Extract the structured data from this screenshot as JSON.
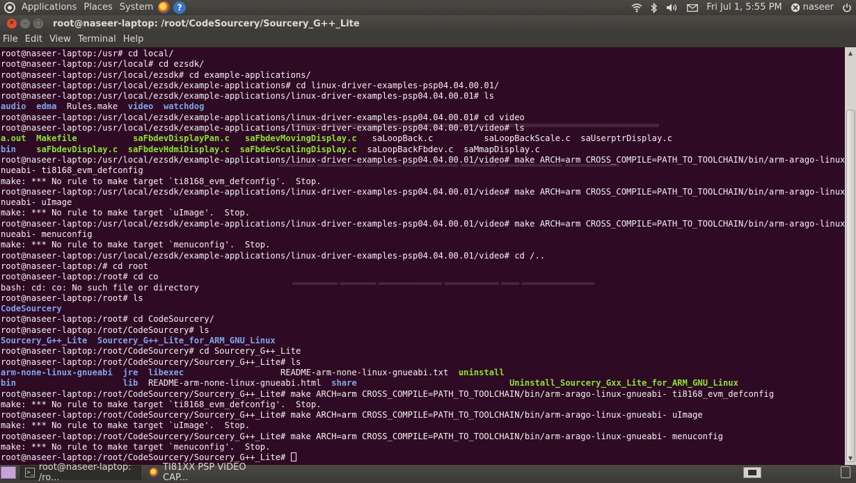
{
  "top_panel": {
    "menus": [
      "Applications",
      "Places",
      "System"
    ],
    "datetime": "Fri Jul  1,  5:55 PM",
    "user": "naseer"
  },
  "window": {
    "title": "root@naseer-laptop: /root/CodeSourcery/Sourcery_G++_Lite",
    "menu": [
      "File",
      "Edit",
      "View",
      "Terminal",
      "Help"
    ]
  },
  "terminal": {
    "lines": [
      [
        {
          "t": "root@naseer-laptop:/usr# cd local/"
        }
      ],
      [
        {
          "t": "root@naseer-laptop:/usr/local# cd ezsdk/"
        }
      ],
      [
        {
          "t": "root@naseer-laptop:/usr/local/ezsdk# cd example-applications/"
        }
      ],
      [
        {
          "t": "root@naseer-laptop:/usr/local/ezsdk/example-applications# cd linux-driver-examples-psp04.04.00.01/"
        }
      ],
      [
        {
          "t": "root@naseer-laptop:/usr/local/ezsdk/example-applications/linux-driver-examples-psp04.04.00.01# ls"
        }
      ],
      [
        {
          "t": "audio",
          "c": "dir"
        },
        {
          "t": "  "
        },
        {
          "t": "edma",
          "c": "dir"
        },
        {
          "t": "  Rules.make  "
        },
        {
          "t": "video",
          "c": "dir"
        },
        {
          "t": "  "
        },
        {
          "t": "watchdog",
          "c": "dir"
        }
      ],
      [
        {
          "t": "root@naseer-laptop:/usr/local/ezsdk/example-applications/linux-driver-examples-psp04.04.00.01# cd video"
        }
      ],
      [
        {
          "t": "root@naseer-laptop:/usr/local/ezsdk/example-applications/linux-driver-examples-psp04.04.00.01/video# ls"
        }
      ],
      [
        {
          "t": "a.out",
          "c": "exe"
        },
        {
          "t": "  "
        },
        {
          "t": "Makefile",
          "c": "exe"
        },
        {
          "t": "           "
        },
        {
          "t": "saFbdevDisplayPan.c",
          "c": "exe"
        },
        {
          "t": "   "
        },
        {
          "t": "saFbdevMovingDisplay.c",
          "c": "exe"
        },
        {
          "t": "   saLoopBack.c          saLoopBackScale.c  saUserptrDisplay.c"
        }
      ],
      [
        {
          "t": "bin",
          "c": "dir"
        },
        {
          "t": "    "
        },
        {
          "t": "saFbdevDisplay.c",
          "c": "exe"
        },
        {
          "t": "  "
        },
        {
          "t": "saFbdevHdmiDisplay.c",
          "c": "exe"
        },
        {
          "t": "  "
        },
        {
          "t": "saFbdevScalingDisplay.c",
          "c": "exe"
        },
        {
          "t": "  saLoopBackFbdev.c  saMmapDisplay.c"
        }
      ],
      [
        {
          "t": "root@naseer-laptop:/usr/local/ezsdk/example-applications/linux-driver-examples-psp04.04.00.01/video# make ARCH=arm CROSS_COMPILE=PATH_TO_TOOLCHAIN/bin/arm-arago-linux-g"
        }
      ],
      [
        {
          "t": "nueabi- ti8168_evm_defconfig"
        }
      ],
      [
        {
          "t": "make: *** No rule to make target `ti8168_evm_defconfig'.  Stop."
        }
      ],
      [
        {
          "t": "root@naseer-laptop:/usr/local/ezsdk/example-applications/linux-driver-examples-psp04.04.00.01/video# make ARCH=arm CROSS_COMPILE=PATH_TO_TOOLCHAIN/bin/arm-arago-linux-g"
        }
      ],
      [
        {
          "t": "nueabi- uImage"
        }
      ],
      [
        {
          "t": "make: *** No rule to make target `uImage'.  Stop."
        }
      ],
      [
        {
          "t": "root@naseer-laptop:/usr/local/ezsdk/example-applications/linux-driver-examples-psp04.04.00.01/video# make ARCH=arm CROSS_COMPILE=PATH_TO_TOOLCHAIN/bin/arm-arago-linux-g"
        }
      ],
      [
        {
          "t": "nueabi- menuconfig"
        }
      ],
      [
        {
          "t": "make: *** No rule to make target `menuconfig'.  Stop."
        }
      ],
      [
        {
          "t": "root@naseer-laptop:/usr/local/ezsdk/example-applications/linux-driver-examples-psp04.04.00.01/video# cd /.."
        }
      ],
      [
        {
          "t": "root@naseer-laptop:/# cd root"
        }
      ],
      [
        {
          "t": "root@naseer-laptop:/root# cd co"
        }
      ],
      [
        {
          "t": "bash: cd: co: No such file or directory"
        }
      ],
      [
        {
          "t": "root@naseer-laptop:/root# ls"
        }
      ],
      [
        {
          "t": "CodeSourcery",
          "c": "dir"
        }
      ],
      [
        {
          "t": "root@naseer-laptop:/root# cd CodeSourcery/"
        }
      ],
      [
        {
          "t": "root@naseer-laptop:/root/CodeSourcery# ls"
        }
      ],
      [
        {
          "t": "Sourcery_G++_Lite",
          "c": "dir"
        },
        {
          "t": "  "
        },
        {
          "t": "Sourcery_G++_Lite_for_ARM_GNU_Linux",
          "c": "dir"
        }
      ],
      [
        {
          "t": "root@naseer-laptop:/root/CodeSourcery# cd Sourcery_G++_Lite"
        }
      ],
      [
        {
          "t": "root@naseer-laptop:/root/CodeSourcery/Sourcery_G++_Lite# ls"
        }
      ],
      [
        {
          "t": "arm-none-linux-gnueabi",
          "c": "dir"
        },
        {
          "t": "  "
        },
        {
          "t": "jre",
          "c": "dir"
        },
        {
          "t": "  "
        },
        {
          "t": "libexec",
          "c": "dir"
        },
        {
          "t": "                   README-arm-none-linux-gnueabi.txt  "
        },
        {
          "t": "uninstall",
          "c": "exe"
        }
      ],
      [
        {
          "t": "bin",
          "c": "dir"
        },
        {
          "t": "                     "
        },
        {
          "t": "lib",
          "c": "dir"
        },
        {
          "t": "  README-arm-none-linux-gnueabi.html  "
        },
        {
          "t": "share",
          "c": "dir"
        },
        {
          "t": "                              "
        },
        {
          "t": "Uninstall_Sourcery_Gxx_Lite_for_ARM_GNU_Linux",
          "c": "exe"
        }
      ],
      [
        {
          "t": "root@naseer-laptop:/root/CodeSourcery/Sourcery_G++_Lite# make ARCH=arm CROSS_COMPILE=PATH_TO_TOOLCHAIN/bin/arm-arago-linux-gnueabi- ti8168_evm_defconfig"
        }
      ],
      [
        {
          "t": "make: *** No rule to make target `ti8168_evm_defconfig'.  Stop."
        }
      ],
      [
        {
          "t": "root@naseer-laptop:/root/CodeSourcery/Sourcery_G++_Lite# make ARCH=arm CROSS_COMPILE=PATH_TO_TOOLCHAIN/bin/arm-arago-linux-gnueabi- uImage"
        }
      ],
      [
        {
          "t": "make: *** No rule to make target `uImage'.  Stop."
        }
      ],
      [
        {
          "t": "root@naseer-laptop:/root/CodeSourcery/Sourcery_G++_Lite# make ARCH=arm CROSS_COMPILE=PATH_TO_TOOLCHAIN/bin/arm-arago-linux-gnueabi- menuconfig"
        }
      ],
      [
        {
          "t": "make: *** No rule to make target `menuconfig'.  Stop."
        }
      ],
      [
        {
          "t": "root@naseer-laptop:/root/CodeSourcery/Sourcery_G++_Lite# "
        }
      ]
    ]
  },
  "taskbar": {
    "tasks": [
      "root@naseer-laptop: /ro...",
      "TI81XX PSP VIDEO CAP..."
    ]
  },
  "colors": {
    "terminal_bg": "#2f0a24",
    "terminal_fg": "#f2f2f2",
    "directory": "#7fa6e6",
    "executable": "#8ae234"
  }
}
